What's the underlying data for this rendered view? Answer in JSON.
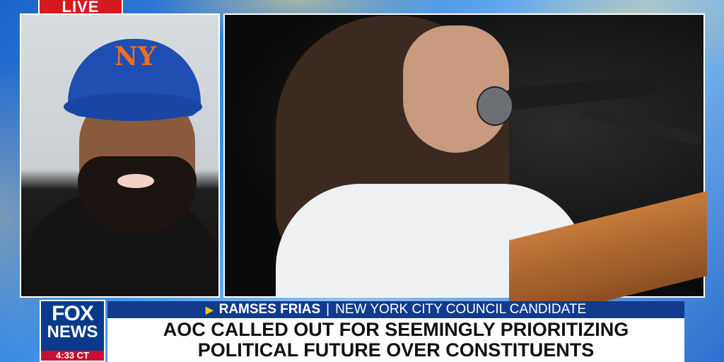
{
  "broadcast": {
    "live_label": "LIVE",
    "network": {
      "logo_line1": "FOX",
      "logo_line2": "NEWS",
      "clock": "4:33 CT"
    },
    "lower_third": {
      "name": "RAMSES FRIAS",
      "separator": "|",
      "title": "NEW YORK CITY COUNCIL CANDIDATE",
      "headline_line1": "AOC CALLED OUT FOR SEEMINGLY PRIORITIZING",
      "headline_line2": "POLITICAL FUTURE OVER CONSTITUENTS"
    },
    "guest_cap_logo": "NY"
  },
  "colors": {
    "live_red": "#d71920",
    "fox_blue": "#0a3a8c",
    "name_bar_blue": "#123b8f",
    "arrow_yellow": "#f5c518",
    "headline_bg": "#ffffff"
  }
}
